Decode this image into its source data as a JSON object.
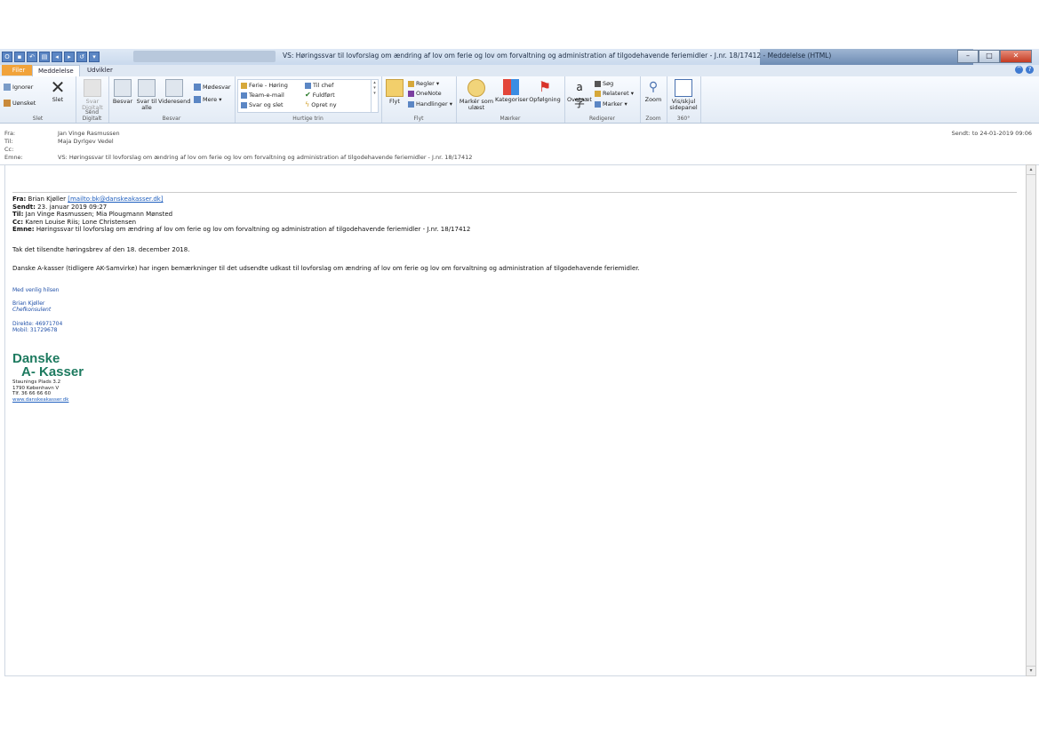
{
  "window": {
    "title": "VS: Høringssvar til lovforslag om ændring af lov om ferie og lov om forvaltning og administration af tilgodehavende feriemidler - J.nr. 18/17412  -  Meddelelse (HTML)"
  },
  "tabs": [
    "Filer",
    "Meddelelse",
    "Udvikler"
  ],
  "ribbon": {
    "slet": {
      "ignorer": "Ignorer",
      "uonsket": "Uønsket",
      "slet": "Slet",
      "label": "Slet"
    },
    "send_digitalt": {
      "svar_digitalt": "Svar Digitalt",
      "label": "Send Digitalt"
    },
    "besvar": {
      "besvar": "Besvar",
      "svar_til_alle": "Svar til alle",
      "videresend": "Videresend",
      "modesvar": "Mødesvar",
      "mere": "Mere",
      "label": "Besvar"
    },
    "hurtige_trin": {
      "items": [
        "Ferie - Høring",
        "Team-e-mail",
        "Svar og slet",
        "Til chef",
        "Fuldført",
        "Opret ny"
      ],
      "label": "Hurtige trin"
    },
    "flyt": {
      "flyt": "Flyt",
      "regler": "Regler",
      "onenote": "OneNote",
      "handlinger": "Handlinger",
      "label": "Flyt"
    },
    "maerker": {
      "marker_som_ulaest": "Markér som ulæst",
      "kategoriser": "Kategoriser",
      "opfolgning": "Opfølgning",
      "label": "Mærker"
    },
    "rediger": {
      "oversaet": "Oversæt",
      "sog": "Søg",
      "relateret": "Relateret",
      "marker": "Marker",
      "label": "Redigerer"
    },
    "zoom": {
      "zoom": "Zoom",
      "label": "Zoom"
    },
    "sidepanel": {
      "vis_skjul": "Vis/skjul sidepanel",
      "label": "360°"
    }
  },
  "header": {
    "from_label": "Fra:",
    "from": "Jan Vinge Rasmussen",
    "to_label": "Til:",
    "to": "Maja Dyrlgev Vedel",
    "cc_label": "Cc:",
    "cc": "",
    "subject_label": "Emne:",
    "subject": "VS: Høringssvar til lovforslag om ændring af lov om ferie og lov om forvaltning og administration af tilgodehavende feriemidler - J.nr. 18/17412",
    "sent": "Sendt:   to 24-01-2019 09:06"
  },
  "forward": {
    "fra_label": "Fra:",
    "fra": "Brian Kjøller",
    "fra_link": "[mailto:bk@danskeakasser.dk]",
    "sendt_label": "Sendt:",
    "sendt": "23. januar 2019 09:27",
    "til_label": "Til:",
    "til": "Jan Vinge Rasmussen; Mia Plougmann Mønsted",
    "cc_label": "Cc:",
    "cc": "Karen Louise Riis; Lone Christensen",
    "emne_label": "Emne:",
    "emne": "Høringssvar til lovforslag om ændring af lov om ferie og lov om forvaltning og administration af tilgodehavende feriemidler - J.nr. 18/17412"
  },
  "body": {
    "p1": "Tak det tilsendte høringsbrev af den 18. december 2018.",
    "p2": "Danske A-kasser (tidligere AK-Samvirke) har ingen bemærkninger til det udsendte udkast til lovforslag om ændring af lov om ferie og lov om forvaltning og administration af tilgodehavende feriemidler.",
    "greeting": "Med venlig hilsen",
    "name": "Brian Kjøller",
    "title": "Chefkonsulent",
    "direct": "Direkte: 46971704",
    "mobile": "Mobil: 31729678",
    "logo_line1": "Danske",
    "logo_line2": "A- Kasser",
    "address1": "Staunings Plads 3.2",
    "address2": "1790 København V",
    "phone": "Tlf. 36 66 66 60",
    "web": "www.danskeakasser.dk"
  },
  "colors": {
    "accent": "#1d7a5f",
    "link": "#1f5fbf",
    "file_tab": "#f1a33a"
  }
}
